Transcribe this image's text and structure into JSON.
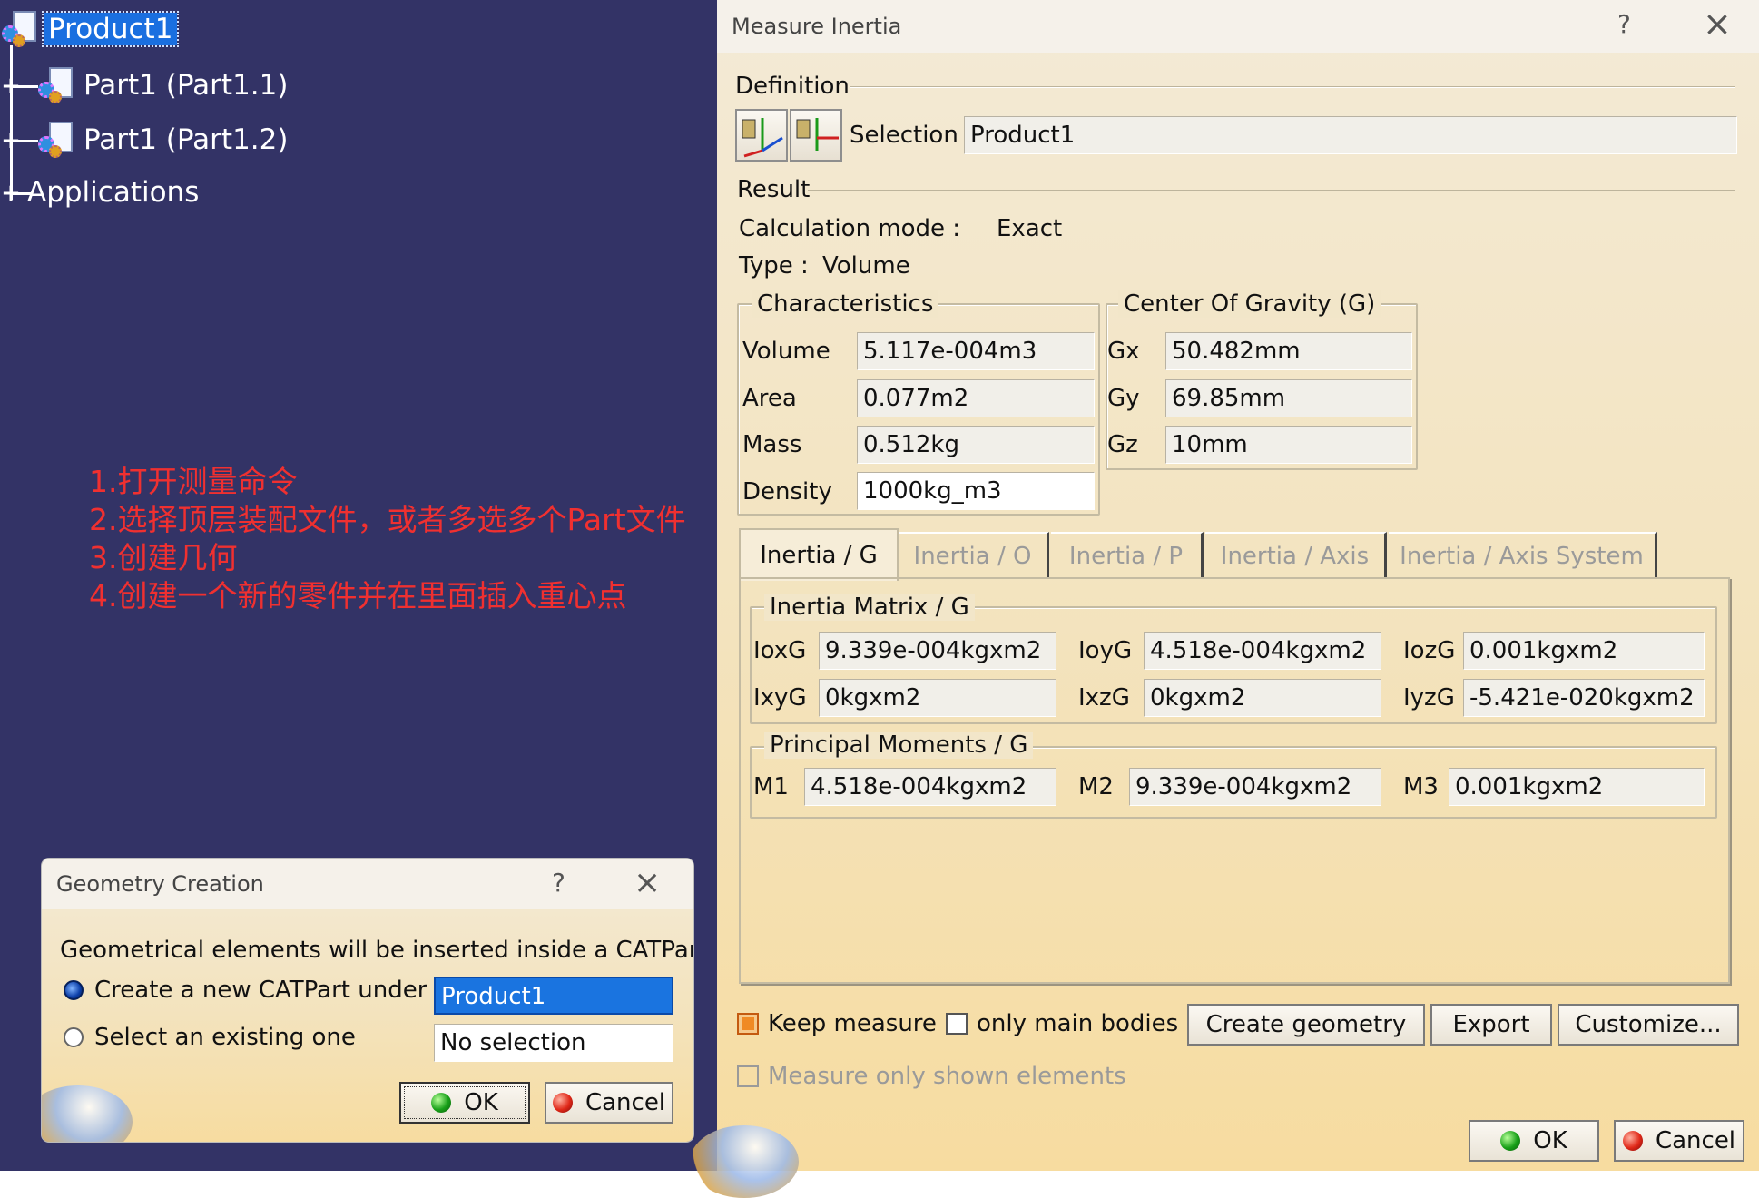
{
  "tree": {
    "root": "Product1",
    "children": [
      "Part1 (Part1.1)",
      "Part1 (Part1.2)"
    ],
    "applications": "Applications"
  },
  "annotation": {
    "lines": [
      "1.打开测量命令",
      "2.选择顶层装配文件，或者多选多个Part文件",
      "3.创建几何",
      "4.创建一个新的零件并在里面插入重心点"
    ],
    "color": "#f03030"
  },
  "measure": {
    "title": "Measure Inertia",
    "help": "?",
    "close": "×",
    "definition_label": "Definition",
    "selection_label": "Selection :",
    "selection_value": "Product1",
    "result_label": "Result",
    "calc_mode_label": "Calculation mode :",
    "calc_mode_value": "Exact",
    "type_label": "Type :",
    "type_value": "Volume",
    "characteristics": {
      "label": "Characteristics",
      "rows": [
        {
          "label": "Volume",
          "value": "5.117e-004m3"
        },
        {
          "label": "Area",
          "value": "0.077m2"
        },
        {
          "label": "Mass",
          "value": "0.512kg"
        },
        {
          "label": "Density",
          "value": "1000kg_m3"
        }
      ]
    },
    "cog": {
      "label": "Center Of Gravity (G)",
      "rows": [
        {
          "label": "Gx",
          "value": "50.482mm"
        },
        {
          "label": "Gy",
          "value": "69.85mm"
        },
        {
          "label": "Gz",
          "value": "10mm"
        }
      ]
    },
    "tabs": [
      "Inertia / G",
      "Inertia / O",
      "Inertia / P",
      "Inertia / Axis",
      "Inertia / Axis System"
    ],
    "matrix": {
      "label": "Inertia Matrix / G",
      "row1": [
        {
          "label": "IoxG",
          "value": "9.339e-004kgxm2"
        },
        {
          "label": "IoyG",
          "value": "4.518e-004kgxm2"
        },
        {
          "label": "IozG",
          "value": "0.001kgxm2"
        }
      ],
      "row2": [
        {
          "label": "IxyG",
          "value": "0kgxm2"
        },
        {
          "label": "IxzG",
          "value": "0kgxm2"
        },
        {
          "label": "IyzG",
          "value": "-5.421e-020kgxm2"
        }
      ]
    },
    "principal": {
      "label": "Principal Moments / G",
      "row": [
        {
          "label": "M1",
          "value": "4.518e-004kgxm2"
        },
        {
          "label": "M2",
          "value": "9.339e-004kgxm2"
        },
        {
          "label": "M3",
          "value": "0.001kgxm2"
        }
      ]
    },
    "keep_measure": "Keep measure",
    "only_main_bodies": "only main bodies",
    "create_geometry": "Create geometry",
    "export": "Export",
    "customize": "Customize...",
    "measure_only_shown": "Measure only shown elements",
    "ok": "OK",
    "cancel": "Cancel"
  },
  "geometry": {
    "title": "Geometry Creation",
    "help": "?",
    "close": "×",
    "message": "Geometrical elements will be inserted inside a CATPart",
    "opt_new": "Create a new CATPart under",
    "opt_new_value": "Product1",
    "opt_existing": "Select an existing one",
    "opt_existing_value": "No selection",
    "ok": "OK",
    "cancel": "Cancel"
  }
}
